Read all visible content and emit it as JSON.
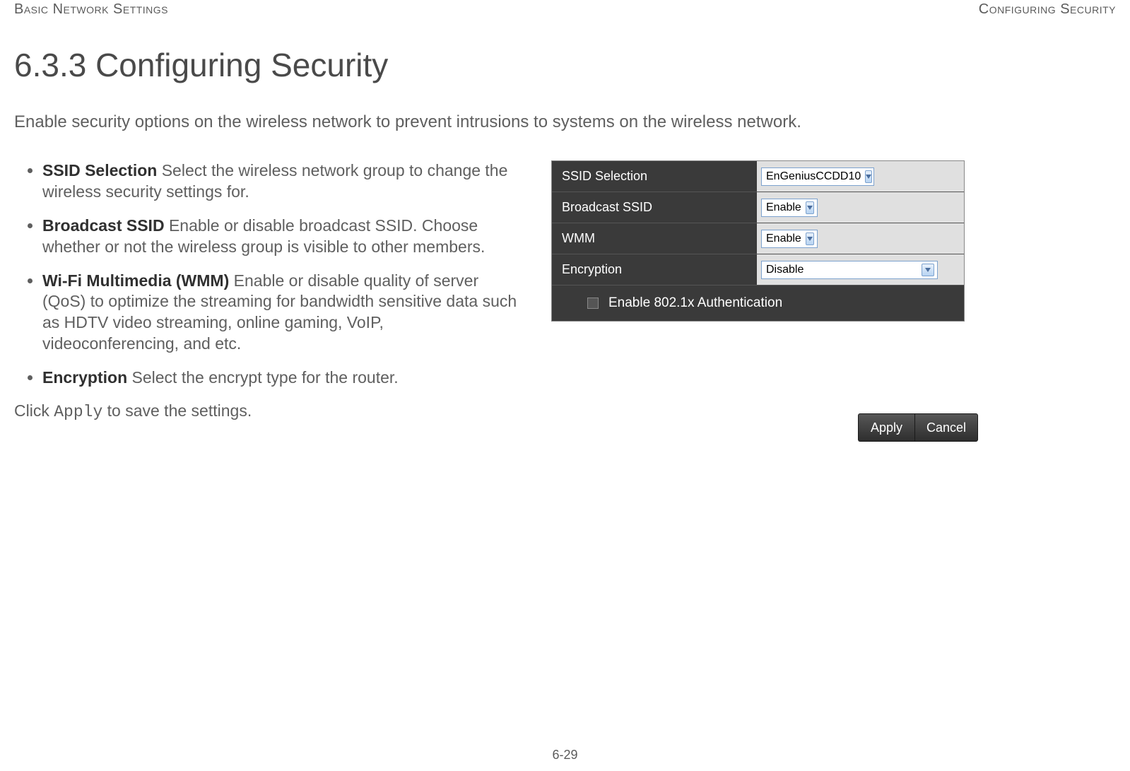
{
  "header": {
    "left": "Basic Network Settings",
    "right": "Configuring Security"
  },
  "title": "6.3.3 Configuring Security",
  "intro": "Enable security options on the wireless network to prevent intrusions to systems on the wireless network.",
  "defs": [
    {
      "term": "SSID Selection",
      "desc": "  Select the wireless network group to change the wireless security settings for."
    },
    {
      "term": "Broadcast SSID",
      "desc": "  Enable or disable broadcast SSID. Choose whether or not the wireless group is visible to other members."
    },
    {
      "term": "Wi-Fi Multimedia (WMM)",
      "desc": "  Enable or disable quality of server (QoS) to optimize the streaming for bandwidth sensitive data such as HDTV video streaming, online gaming, VoIP, videoconferencing, and etc."
    },
    {
      "term": "Encryption",
      "desc": "  Select the encrypt type for the router."
    }
  ],
  "apply_note_pre": "Click ",
  "apply_note_code": "Apply",
  "apply_note_post": " to save the settings.",
  "panel": {
    "rows": [
      {
        "label": "SSID Selection",
        "value": "EnGeniusCCDD10"
      },
      {
        "label": "Broadcast SSID",
        "value": "Enable"
      },
      {
        "label": "WMM",
        "value": "Enable"
      },
      {
        "label": "Encryption",
        "value": "Disable"
      }
    ],
    "auth_label": "Enable 802.1x Authentication"
  },
  "buttons": {
    "apply": "Apply",
    "cancel": "Cancel"
  },
  "page_num": "6-29"
}
